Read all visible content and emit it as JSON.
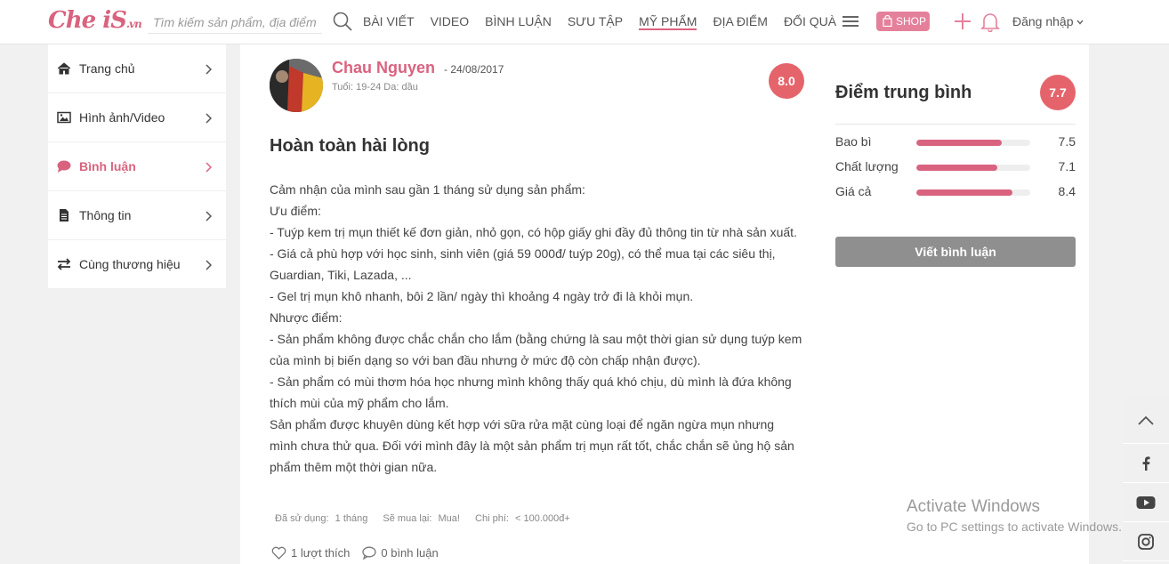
{
  "header": {
    "logo_main": "Che iS",
    "logo_suffix": ".vn",
    "search_placeholder": "Tìm kiếm sản phẩm, địa điểm",
    "nav": [
      "BÀI VIẾT",
      "VIDEO",
      "BÌNH LUẬN",
      "SƯU TẬP",
      "MỸ PHẨM",
      "ĐỊA ĐIỂM",
      "ĐỔI QUÀ"
    ],
    "shop_label": "SHOP",
    "login_label": "Đăng nhập",
    "accent_color": "#d9637f"
  },
  "sidebar": {
    "items": [
      {
        "label": "Trang chủ",
        "icon": "home-icon"
      },
      {
        "label": "Hình ảnh/Video",
        "icon": "image-icon"
      },
      {
        "label": "Bình luận",
        "icon": "comment-icon"
      },
      {
        "label": "Thông tin",
        "icon": "document-icon"
      },
      {
        "label": "Cùng thương hiệu",
        "icon": "swap-icon"
      }
    ]
  },
  "review": {
    "author": "Chau Nguyen",
    "date": "- 24/08/2017",
    "meta": "Tuổi: 19-24 Da: dầu",
    "score": "8.0",
    "title": "Hoàn toàn hài lòng",
    "body": [
      "Cảm nhận của mình sau gần 1 tháng sử dụng sản phẩm:",
      "Ưu điểm:",
      "- Tuýp kem trị mụn thiết kế đơn giản, nhỏ gọn, có hộp giấy ghi đầy đủ thông tin từ nhà sản xuất.",
      "- Giá cả phù hợp với học sinh, sinh viên (giá 59 000đ/ tuýp 20g), có thể mua tại các siêu thị, Guardian, Tiki, Lazada, ...",
      "- Gel trị mụn khô nhanh, bôi 2 lần/ ngày thì khoảng 4 ngày trở đi là khỏi mụn.",
      "Nhược điểm:",
      "- Sản phẩm không được chắc chắn cho lắm (bằng chứng là sau một thời gian sử dụng tuýp kem của mình bị biến dạng so với ban đầu nhưng ở mức độ còn chấp nhận được).",
      "- Sản phẩm có mùi thơm hóa học nhưng mình không thấy quá khó chịu, dù mình là đứa không thích mùi của mỹ phẩm cho lắm.",
      "Sản phẩm được khuyên dùng kết hợp với sữa rửa mặt cùng loại để ngăn ngừa mụn nhưng mình chưa thử qua. Đối với mình đây là một sản phẩm trị mụn rất tốt, chắc chắn sẽ ủng hộ sản phẩm thêm một thời gian nữa."
    ],
    "usage": {
      "used_label": "Đã sử dụng:",
      "used_value": "1 tháng",
      "rebuy_label": "Sẽ mua lại:",
      "rebuy_value": "Mua!",
      "cost_label": "Chi phí:",
      "cost_value": "< 100.000đ+"
    },
    "likes": "1 lượt thích",
    "comments": "0 bình luận"
  },
  "summary": {
    "title": "Điểm trung bình",
    "average": "7.7",
    "ratings": [
      {
        "label": "Bao bì",
        "value": "7.5",
        "fraction": 0.75
      },
      {
        "label": "Chất lượng",
        "value": "7.1",
        "fraction": 0.71
      },
      {
        "label": "Giá cả",
        "value": "8.4",
        "fraction": 0.84
      }
    ],
    "write_button": "Viết bình luận"
  },
  "social": [
    "chevron-up-icon",
    "facebook-icon",
    "youtube-icon",
    "instagram-icon"
  ],
  "watermark": {
    "line1": "Activate Windows",
    "line2": "Go to PC settings to activate Windows."
  }
}
